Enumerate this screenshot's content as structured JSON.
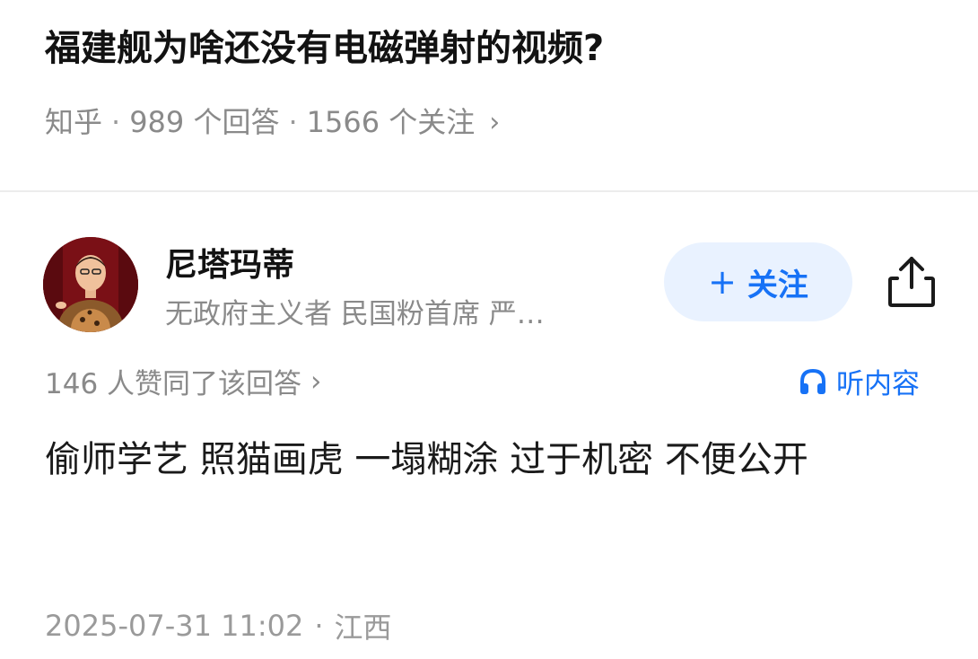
{
  "question": {
    "title": "福建舰为啥还没有电磁弹射的视频?",
    "source": "知乎",
    "answers_count": "989 个回答",
    "followers_count": "1566 个关注",
    "separator": "·",
    "chevron": "›"
  },
  "author": {
    "name": "尼塔玛蒂",
    "bio": "无政府主义者 民国粉首席 严…",
    "avatar_icon": "avatar-photo"
  },
  "actions": {
    "follow_plus": "+",
    "follow_label": "关注",
    "share_icon": "share-icon",
    "accent_color": "#1772f6",
    "follow_bg_color": "#e9f2ff"
  },
  "answer": {
    "likes_text": "146 人赞同了该回答",
    "likes_chevron": "›",
    "listen_label": "听内容",
    "listen_icon": "headphones-icon",
    "content": "偷师学艺 照猫画虎 一塌糊涂 过于机密 不便公开",
    "date": "2025-07-31 11:02",
    "location": "江西",
    "separator": "·"
  }
}
